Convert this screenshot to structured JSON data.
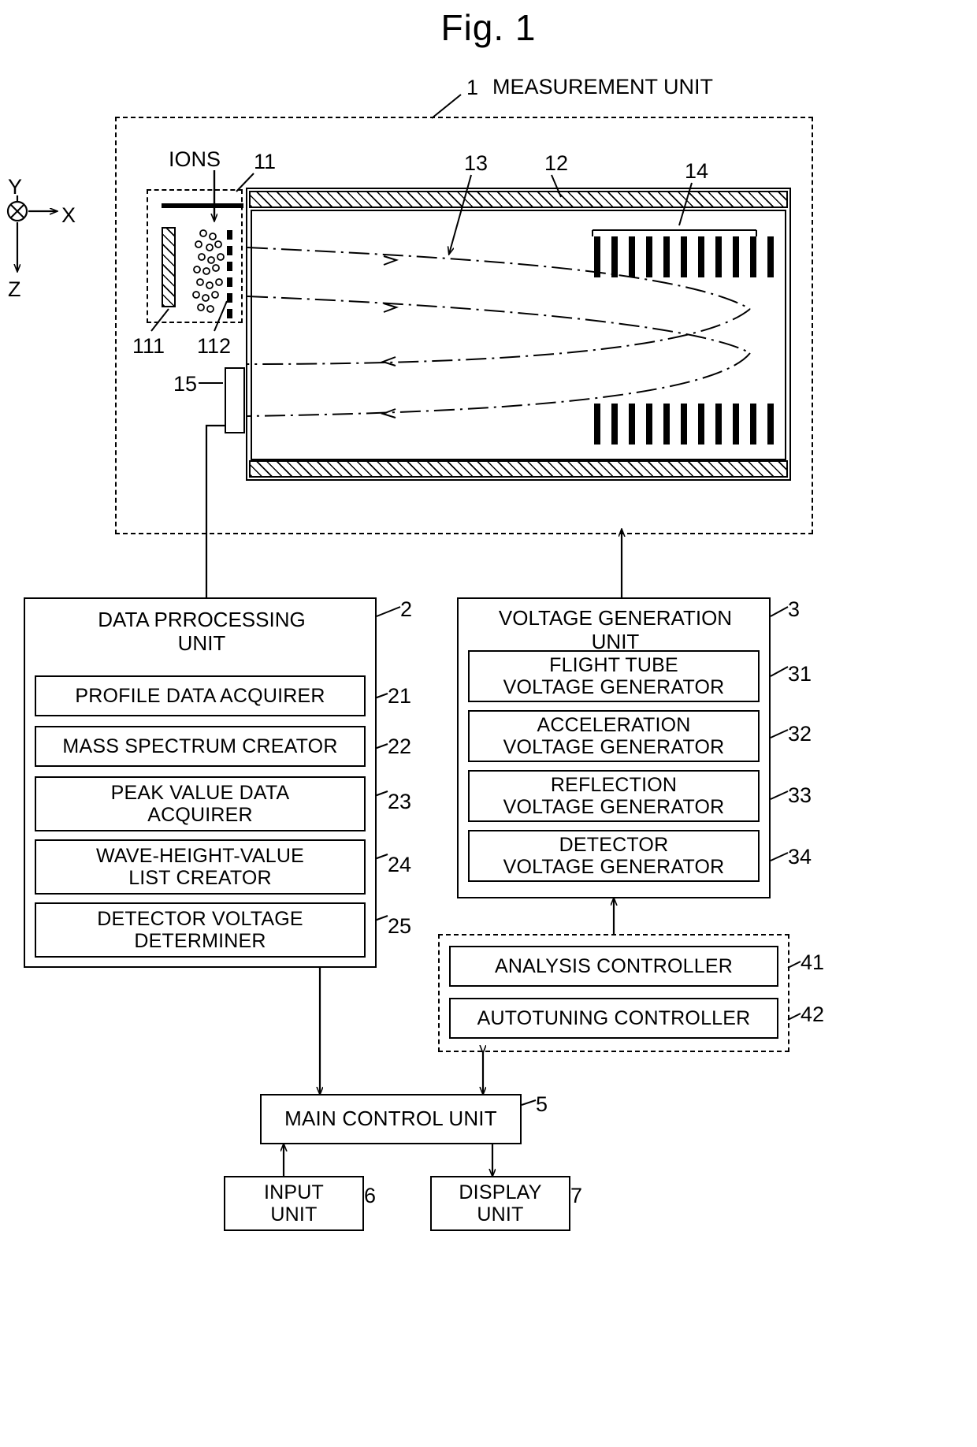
{
  "figure": {
    "title": "Fig. 1",
    "top_label_number": "1",
    "top_label_text": "MEASUREMENT UNIT"
  },
  "axes": {
    "y": "Y",
    "x": "X",
    "z": "Z",
    "origin_icon": "circled-cross-icon"
  },
  "instrument": {
    "ions_label": "IONS",
    "callouts": [
      {
        "id": "11",
        "desc": "ion-source-region"
      },
      {
        "id": "111",
        "desc": "sample-plate"
      },
      {
        "id": "112",
        "desc": "extraction-grid"
      },
      {
        "id": "12",
        "desc": "flight-tube"
      },
      {
        "id": "13",
        "desc": "ion-flight-path"
      },
      {
        "id": "14",
        "desc": "reflectron-electrodes"
      },
      {
        "id": "15",
        "desc": "detector"
      }
    ]
  },
  "blocks": {
    "data_processing": {
      "title": "DATA PRROCESSING\nUNIT",
      "title_line1": "DATA PRROCESSING",
      "title_line2": "UNIT",
      "number": "2",
      "items": [
        {
          "label": "PROFILE DATA ACQUIRER",
          "number": "21"
        },
        {
          "label": "MASS SPECTRUM CREATOR",
          "number": "22"
        },
        {
          "label": "PEAK VALUE DATA\nACQUIRER",
          "number": "23"
        },
        {
          "label": "WAVE-HEIGHT-VALUE\nLIST CREATOR",
          "number": "24"
        },
        {
          "label": "DETECTOR VOLTAGE\nDETERMINER",
          "number": "25"
        }
      ]
    },
    "voltage_generation": {
      "title_line1": "VOLTAGE GENERATION",
      "title_line2": "UNIT",
      "number": "3",
      "items": [
        {
          "label": "FLIGHT TUBE\nVOLTAGE GENERATOR",
          "number": "31"
        },
        {
          "label": "ACCELERATION\nVOLTAGE GENERATOR",
          "number": "32"
        },
        {
          "label": "REFLECTION\nVOLTAGE GENERATOR",
          "number": "33"
        },
        {
          "label": "DETECTOR\nVOLTAGE GENERATOR",
          "number": "34"
        }
      ]
    },
    "controllers": {
      "items": [
        {
          "label": "ANALYSIS CONTROLLER",
          "number": "41"
        },
        {
          "label": "AUTOTUNING CONTROLLER",
          "number": "42"
        }
      ]
    },
    "main_control": {
      "label": "MAIN CONTROL UNIT",
      "number": "5"
    },
    "input_unit": {
      "label": "INPUT\nUNIT",
      "number": "6"
    },
    "display_unit": {
      "label": "DISPLAY\nUNIT",
      "number": "7"
    }
  },
  "colors": {
    "line": "#000000",
    "background": "#ffffff"
  }
}
